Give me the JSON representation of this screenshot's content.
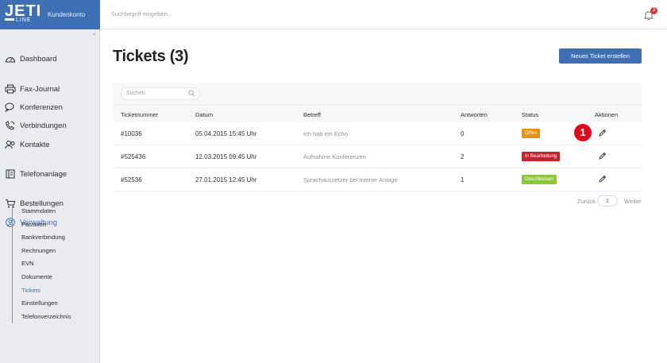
{
  "header": {
    "logo_text": "JETI",
    "logo_sub": "LINE",
    "brand_subtitle": "Kundenkonto",
    "search_placeholder": "Suchbegriff eingeben...",
    "notification_count": "3"
  },
  "sidebar": {
    "items": [
      {
        "label": "Dashboard",
        "icon": "dashboard-icon"
      },
      {
        "label": "Fax-Journal",
        "icon": "printer-icon"
      },
      {
        "label": "Konferenzen",
        "icon": "chat-icon"
      },
      {
        "label": "Verbindungen",
        "icon": "phone-icon"
      },
      {
        "label": "Kontakte",
        "icon": "contacts-icon"
      },
      {
        "label": "Telefonanlage",
        "icon": "switchboard-icon"
      },
      {
        "label": "Bestellungen",
        "icon": "cart-icon"
      },
      {
        "label": "Verwaltung",
        "icon": "user-circle-icon"
      }
    ],
    "subitems": [
      "Stammdaten",
      "Passwort",
      "Bankverbindung",
      "Rechnungen",
      "EVN",
      "Dokumente",
      "Tickets",
      "Einstellungen",
      "Telefonverzeichnis"
    ],
    "active_subitem": "Tickets"
  },
  "main": {
    "title": "Tickets (3)",
    "new_ticket_button": "Neues Ticket erstellen",
    "search_placeholder": "Suchen",
    "columns": [
      "Ticketnummer",
      "Datum",
      "Betreff",
      "Antworten",
      "Status",
      "Aktionen"
    ],
    "rows": [
      {
        "number": "#10036",
        "date": "05.04.2015 15:45 Uhr",
        "subject": "Ich hab ein Echo",
        "replies": "0",
        "status": "Offen",
        "status_color": "#e8901a"
      },
      {
        "number": "#525436",
        "date": "12.03.2015 09:45 Uhr",
        "subject": "Aufnahme Konferenzen",
        "replies": "2",
        "status": "In Bearbeitung",
        "status_color": "#c0272d"
      },
      {
        "number": "#52536",
        "date": "27.01.2015 12:45 Uhr",
        "subject": "Sprachaussetzer bei meiner Anlage",
        "replies": "1",
        "status": "Geschlossen",
        "status_color": "#8dc63f"
      }
    ],
    "pagination": {
      "prev": "Zurück",
      "page": "1",
      "next": "Weiter"
    },
    "marker": "1"
  },
  "colors": {
    "brand": "#3f6fb3",
    "sidebar_bg": "#e9ebee"
  }
}
